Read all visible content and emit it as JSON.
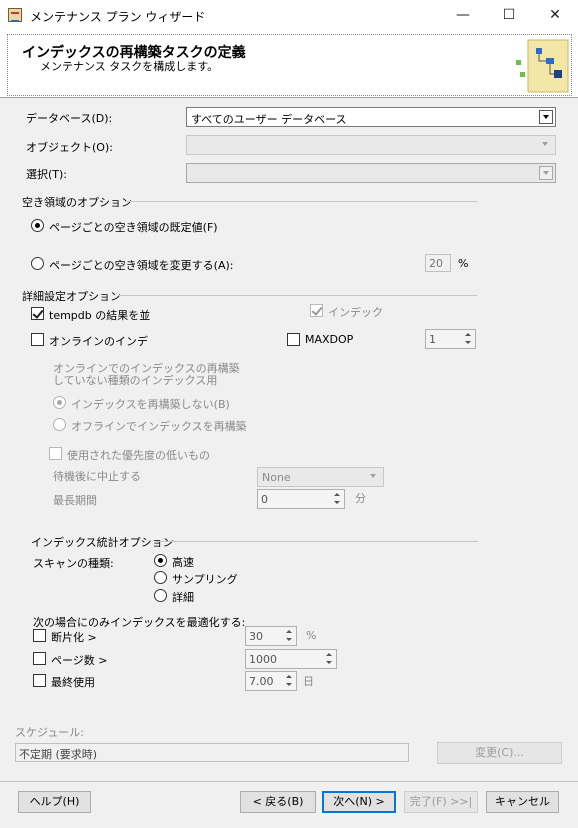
{
  "window": {
    "title": "メンテナンス プラン ウィザード",
    "minimize": "—",
    "maximize": "☐",
    "close": "✕"
  },
  "header": {
    "title": "インデックスの再構築タスクの定義",
    "subtitle": "メンテナンス タスクを構成します。"
  },
  "database": {
    "label": "データベース(D):",
    "value": "すべてのユーザー データベース"
  },
  "object": {
    "label": "オブジェクト(O):",
    "value": ""
  },
  "selection": {
    "label": "選択(T):",
    "value": ""
  },
  "free_space": {
    "group_label": "空き領域のオプション",
    "default_label": "ページごとの空き領域の既定値(F)",
    "change_label": "ページごとの空き領域を変更する(A):",
    "percent_value": "20",
    "percent_unit": "%"
  },
  "advanced": {
    "group_label": "詳細設定オプション",
    "tempdb_label": "tempdb の結果を並",
    "index_label": "インデック",
    "online_label": "オンラインのインデ",
    "maxdop_label": "MAXDOP",
    "maxdop_value": "1",
    "note_line1": "オンラインでのインデックスの再構築",
    "note_line2": "していない種類のインデックス用",
    "no_rebuild_label": "インデックスを再構築しない(B)",
    "offline_label": "オフラインでインデックスを再構築",
    "low_priority_label": "使用された優先度の低いもの",
    "abort_label": "待機後に中止する",
    "abort_value": "None",
    "max_duration_label": "最長期間",
    "max_duration_value": "0",
    "max_duration_unit": "分"
  },
  "stats": {
    "group_label": "インデックス統計オプション",
    "scan_label": "スキャンの種類:",
    "fast": "高速",
    "sampling": "サンプリング",
    "detailed": "詳細"
  },
  "optimize": {
    "heading": "次の場合にのみインデックスを最適化する:",
    "fragmentation_label": "断片化 >",
    "fragmentation_value": "30",
    "fragmentation_unit": "%",
    "page_count_label": "ページ数 >",
    "page_count_value": "1000",
    "last_used_label": "最終使用",
    "last_used_value": "7.00",
    "last_used_unit": "日"
  },
  "schedule": {
    "label": "スケジュール:",
    "value": "不定期 (要求時)",
    "change_button": "変更(C)..."
  },
  "footer": {
    "help": "ヘルプ(H)",
    "back": "< 戻る(B)",
    "next": "次へ(N) >",
    "finish": "完了(F) >>|",
    "cancel": "キャンセル"
  }
}
